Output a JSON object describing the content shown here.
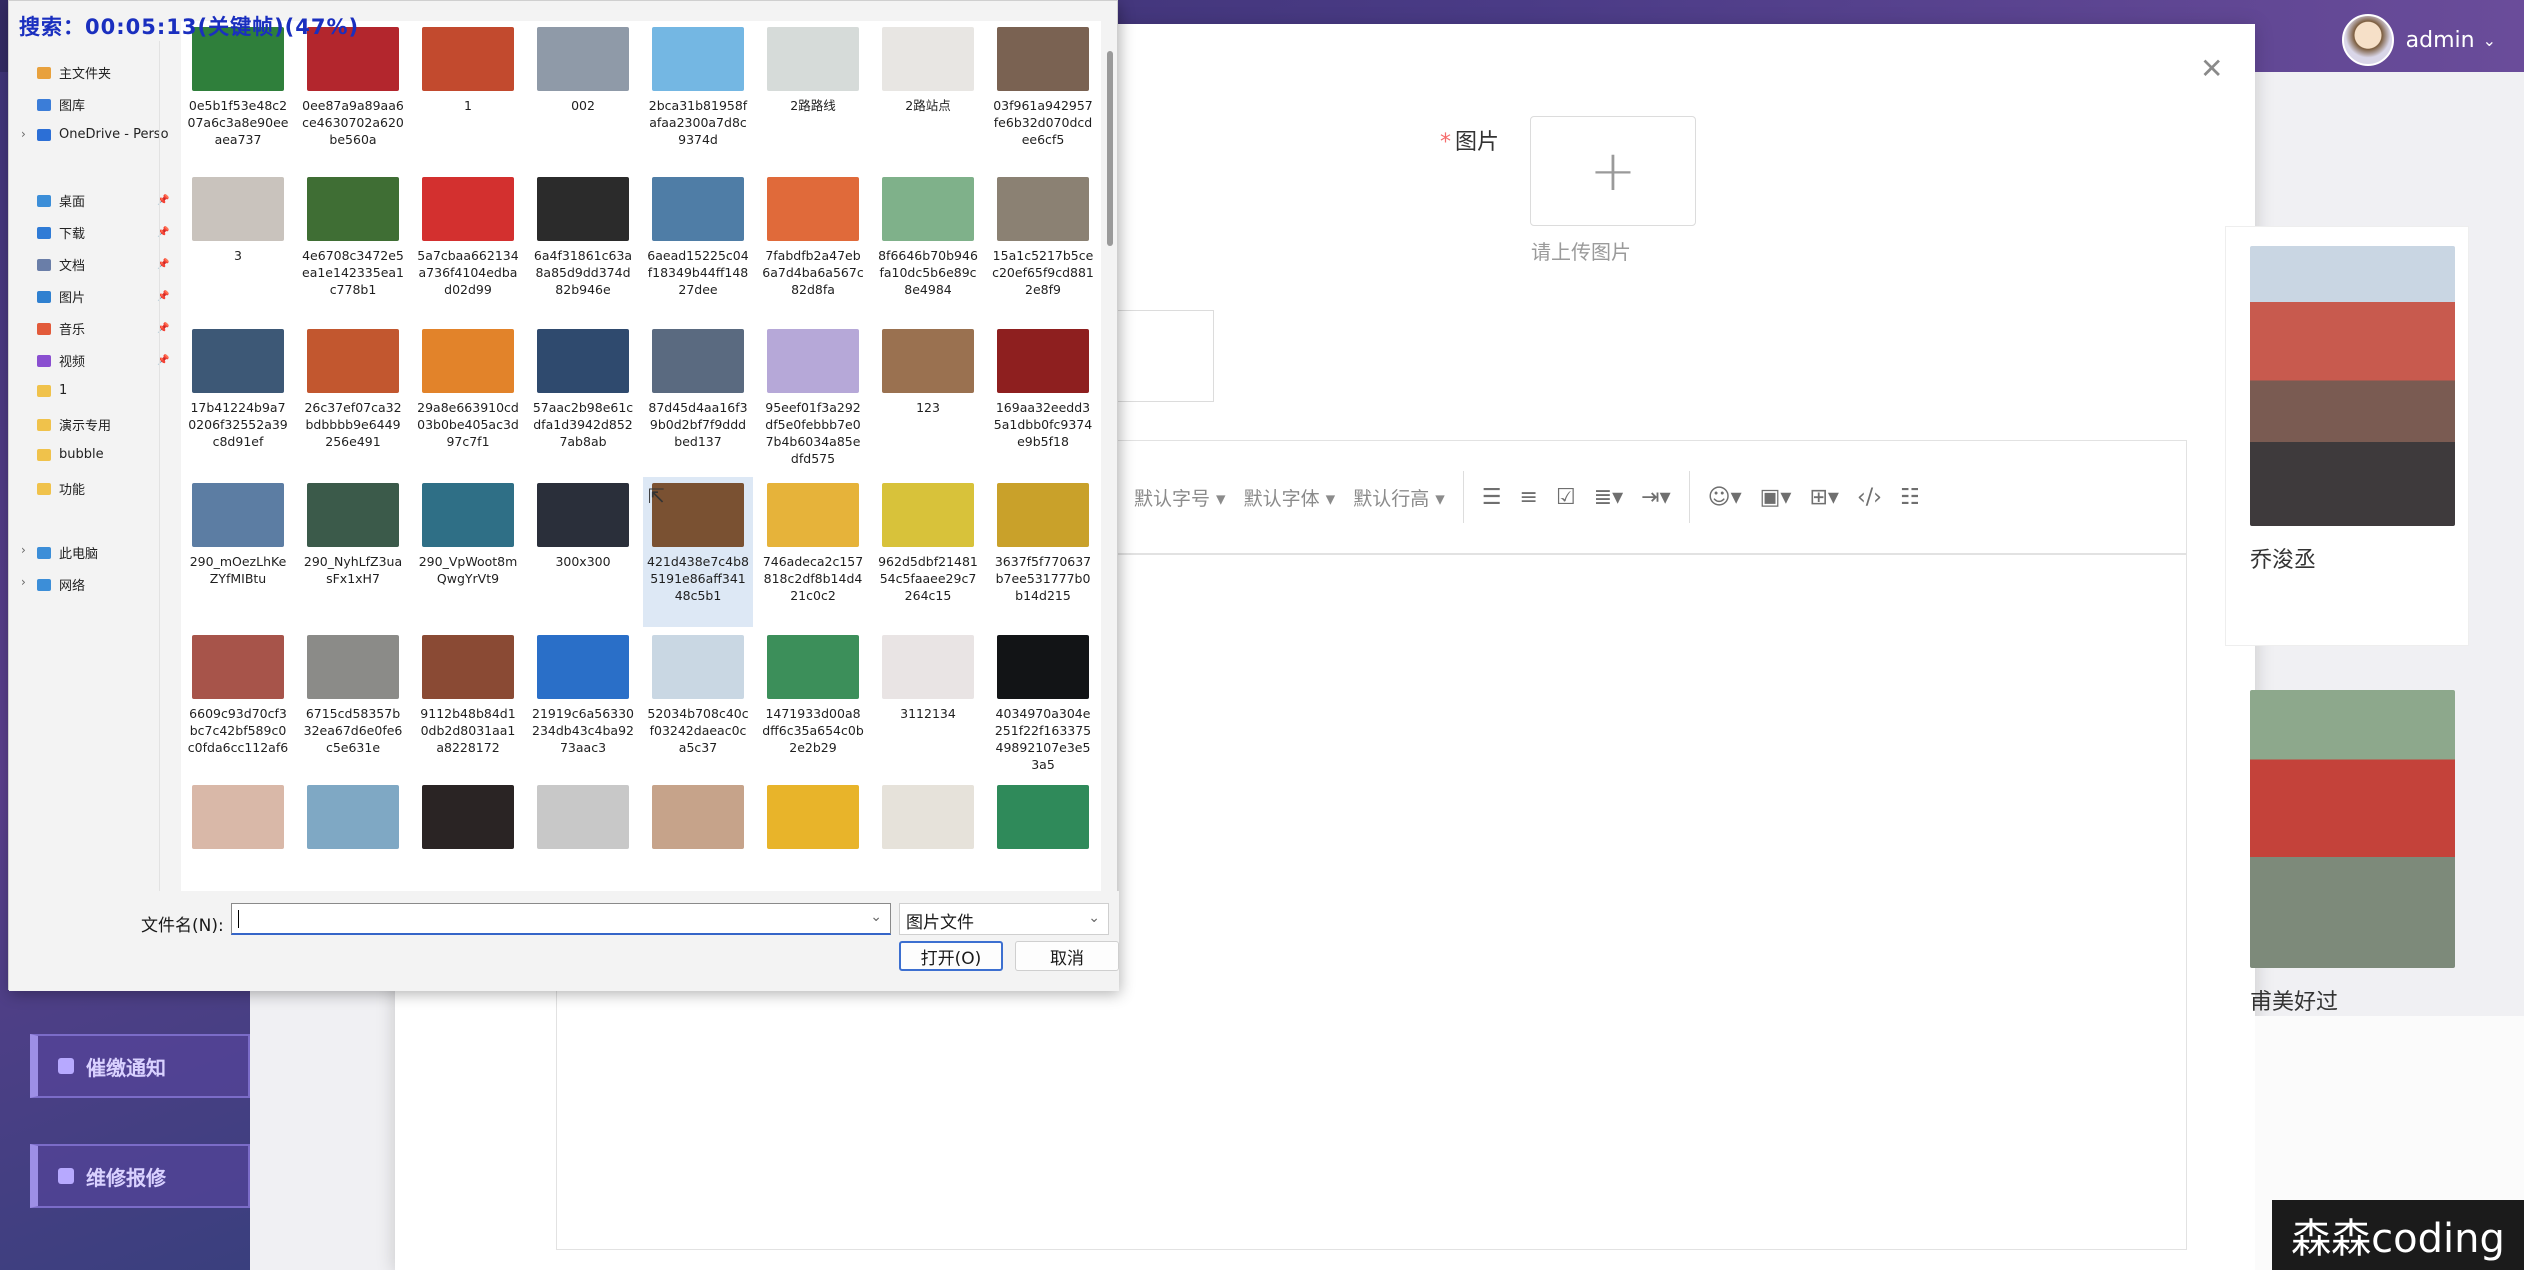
{
  "web": {
    "admin_label": "admin",
    "nav": [
      {
        "label": "催缴通知"
      },
      {
        "label": "维修报修"
      }
    ],
    "modal": {
      "image_label": "图片",
      "upload_hint": "请上传图片",
      "toolbar": {
        "font_size": "默认字号",
        "font_family": "默认字体",
        "line_height": "默认行高"
      }
    },
    "cards": [
      {
        "caption": "乔浚丞"
      },
      {
        "caption": "甫美好过"
      }
    ]
  },
  "dialog": {
    "recording": "搜索：00:05:13(关键帧)(47%)",
    "sidebar": [
      {
        "label": "主文件夹",
        "color": "#e8a13d"
      },
      {
        "label": "图库",
        "color": "#3b7dd8"
      },
      {
        "label": "OneDrive - Perso",
        "color": "#2c6fd6"
      },
      {
        "label": "桌面",
        "color": "#3c8ed8"
      },
      {
        "label": "下载",
        "color": "#2f7bd6"
      },
      {
        "label": "文档",
        "color": "#6a7ea8"
      },
      {
        "label": "图片",
        "color": "#2f80d0"
      },
      {
        "label": "音乐",
        "color": "#e25a3a"
      },
      {
        "label": "视频",
        "color": "#8a4fd0"
      },
      {
        "label": "1",
        "color": "#f0c24b"
      },
      {
        "label": "演示专用",
        "color": "#f0c24b"
      },
      {
        "label": "bubble",
        "color": "#f0c24b"
      },
      {
        "label": "功能",
        "color": "#f0c24b"
      },
      {
        "label": "此电脑",
        "color": "#3c8ed8"
      },
      {
        "label": "网络",
        "color": "#3c8ed8"
      }
    ],
    "files": [
      {
        "name": "0e5b1f53e48c207a6c3a8e90eeaea737",
        "color": "#2f7f3b"
      },
      {
        "name": "0ee87a9a89aa6ce4630702a620be560a",
        "color": "#b3262d"
      },
      {
        "name": "1",
        "color": "#c24a2e"
      },
      {
        "name": "002",
        "color": "#8f9aa8"
      },
      {
        "name": "2bca31b81958fafaa2300a7d8c9374d",
        "color": "#74b7e3"
      },
      {
        "name": "2路路线",
        "color": "#d6dbd9"
      },
      {
        "name": "2路站点",
        "color": "#e8e6e3"
      },
      {
        "name": "03f961a942957fe6b32d070dcdee6cf5",
        "color": "#7a6252"
      },
      {
        "name": "3",
        "color": "#c9c3bd"
      },
      {
        "name": "4e6708c3472e5ea1e142335ea1c778b1",
        "color": "#3f6e34"
      },
      {
        "name": "5a7cbaa662134a736f4104edbad02d99",
        "color": "#d3302f"
      },
      {
        "name": "6a4f31861c63a8a85d9dd374d82b946e",
        "color": "#2b2b2b"
      },
      {
        "name": "6aead15225c04f18349b44ff14827dee",
        "color": "#4f7da6"
      },
      {
        "name": "7fabdfb2a47eb6a7d4ba6a567c82d8fa",
        "color": "#e06a3a"
      },
      {
        "name": "8f6646b70b946fa10dc5b6e89c8e4984",
        "color": "#7fb18a"
      },
      {
        "name": "15a1c5217b5cec20ef65f9cd8812e8f9",
        "color": "#8b8173"
      },
      {
        "name": "17b41224b9a70206f32552a39c8d91ef",
        "color": "#3d5876"
      },
      {
        "name": "26c37ef07ca32bdbbbb9e6449256e491",
        "color": "#c2572f"
      },
      {
        "name": "29a8e663910cd03b0be405ac3d97c7f1",
        "color": "#e2832a"
      },
      {
        "name": "57aac2b98e61cdfa1d3942d8527ab8ab",
        "color": "#2f4a6e"
      },
      {
        "name": "87d45d4aa16f39b0d2bf7f9dddbed137",
        "color": "#5a6a80"
      },
      {
        "name": "95eef01f3a292df5e0febbb7e07b4b6034a85edfd575",
        "color": "#b6a8d8"
      },
      {
        "name": "123",
        "color": "#9a7150"
      },
      {
        "name": "169aa32eedd35a1dbb0fc9374e9b5f18",
        "color": "#8e1f1f"
      },
      {
        "name": "290_mOezLhKeZYfMIBtu",
        "color": "#5c7da3"
      },
      {
        "name": "290_NyhLfZ3uasFx1xH7",
        "color": "#3b5a4a"
      },
      {
        "name": "290_VpWoot8mQwgYrVt9",
        "color": "#2f6f86"
      },
      {
        "name": "300x300",
        "color": "#2a2f3a"
      },
      {
        "name": "421d438e7c4b85191e86aff34148c5b1",
        "color": "#7a5132"
      },
      {
        "name": "746adeca2c157818c2df8b14d421c0c2",
        "color": "#e6b33a"
      },
      {
        "name": "962d5dbf2148154c5faaee29c7264c15",
        "color": "#d8c23a"
      },
      {
        "name": "3637f5f770637b7ee531777b0b14d215",
        "color": "#c9a12a"
      },
      {
        "name": "6609c93d70cf3bc7c42bf589c0c0fda6cc112af6",
        "color": "#a7544a"
      },
      {
        "name": "6715cd58357b32ea67d6e0fe6c5e631e",
        "color": "#8b8b88"
      },
      {
        "name": "9112b48b84d10db2d8031aa1a8228172",
        "color": "#8a4a34"
      },
      {
        "name": "21919c6a56330234db43c4ba9273aac3",
        "color": "#2a6fc8"
      },
      {
        "name": "52034b708c40cf03242daeac0ca5c37",
        "color": "#c9d7e3"
      },
      {
        "name": "1471933d00a8dff6c35a654c0b2e2b29",
        "color": "#3c8f5a"
      },
      {
        "name": "3112134",
        "color": "#e9e4e4"
      },
      {
        "name": "4034970a304e251f22f16337549892107e3e53a5",
        "color": "#121416"
      },
      {
        "name": "",
        "color": "#d9b8a8"
      },
      {
        "name": "",
        "color": "#7fa8c4"
      },
      {
        "name": "",
        "color": "#2a2424"
      },
      {
        "name": "",
        "color": "#c8c8c8"
      },
      {
        "name": "",
        "color": "#c6a38a"
      },
      {
        "name": "",
        "color": "#e8b42a"
      },
      {
        "name": "",
        "color": "#e6e2da"
      },
      {
        "name": "",
        "color": "#2f8a5a"
      }
    ],
    "filename_label": "文件名(N):",
    "filename_value": "",
    "file_type": "图片文件",
    "open_button": "打开(O)",
    "cancel_button": "取消"
  },
  "watermark": "森森coding"
}
